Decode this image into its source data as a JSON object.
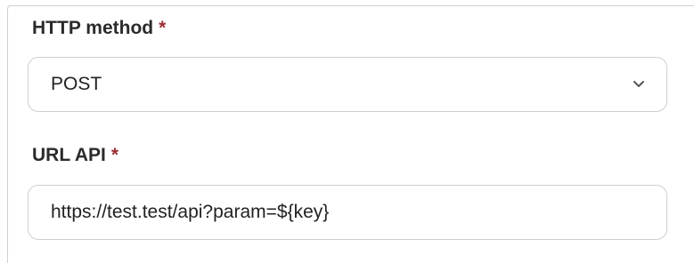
{
  "form": {
    "http_method": {
      "label": "HTTP method",
      "required_mark": "*",
      "selected_value": "POST"
    },
    "url_api": {
      "label": "URL API",
      "required_mark": "*",
      "value": "https://test.test/api?param=${key}"
    }
  },
  "icons": {
    "dropdown": "chevron-down-icon"
  },
  "colors": {
    "required_mark": "#9b2f36",
    "border": "#cfcfcf",
    "label_text": "#2b2b2b"
  }
}
